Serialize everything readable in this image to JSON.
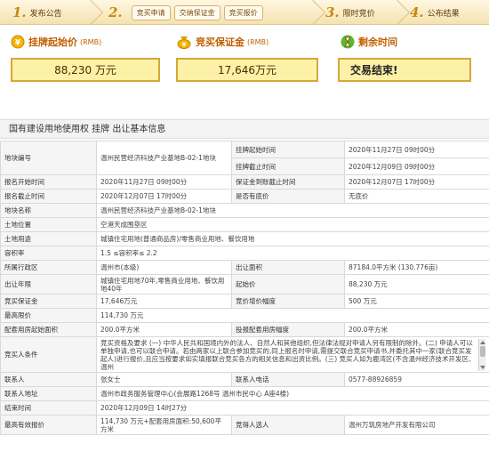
{
  "steps": {
    "s1": {
      "num": "1.",
      "label": "发布公告"
    },
    "s2": {
      "num": "2.",
      "subs": [
        "竞买申请",
        "交纳保证金",
        "竞买报价"
      ]
    },
    "s3": {
      "num": "3.",
      "label": "限时竞价"
    },
    "s4": {
      "num": "4.",
      "label": "公布结果"
    }
  },
  "prices": {
    "start_label": "挂牌起始价",
    "start_unit": "(RMB)",
    "start_value": "88,230 万元",
    "deposit_label": "竞买保证金",
    "deposit_unit": "(RMB)",
    "deposit_value": "17,646万元",
    "remain_label": "剩余时间",
    "remain_value": "交易结束!"
  },
  "section_title": "国有建设用地使用权 挂牌 出让基本信息",
  "rows": {
    "r1": {
      "k1": "地块编号",
      "v1": "温州民营经济科技产业基地B-02-1地块",
      "k2": "挂牌起始时间",
      "v2": "2020年11月27日 09时00分"
    },
    "r1b": {
      "k2": "挂牌截止时间",
      "v2": "2020年12月09日 09时00分"
    },
    "r2": {
      "k1": "报名开始时间",
      "v1": "2020年11月27日 09时00分",
      "k2": "保证金到账截止时间",
      "v2": "2020年12月07日 17时00分"
    },
    "r3": {
      "k1": "报名截止时间",
      "v1": "2020年12月07日 17时00分",
      "k2": "是否有底价",
      "v2": "无底价"
    },
    "r4": {
      "k1": "地块名称",
      "v1": "温州民营经济科技产业基地B-02-1地块"
    },
    "r5": {
      "k1": "土地位置",
      "v1": "空港天成围垦区"
    },
    "r6": {
      "k1": "土地用途",
      "v1": "城镇住宅用地(普通商品房)/零售商业用地、餐饮用地"
    },
    "r7": {
      "k1": "容积率",
      "v1": "1.5 ≤容积率≤ 2.2"
    },
    "r8": {
      "k1": "所属行政区",
      "v1": "温州市(本级)",
      "k2": "出让面积",
      "v2": "87184.0平方米 (130.776亩)"
    },
    "r9": {
      "k1": "出让年限",
      "v1": "城镇住宅用地70年,零售商业用地、餐饮用地40年",
      "k2": "起始价",
      "v2": "88,230 万元"
    },
    "r10": {
      "k1": "竞买保证金",
      "v1": "17,646万元",
      "k2": "竞价增价幅度",
      "v2": "500 万元"
    },
    "r11": {
      "k1": "最高限价",
      "v1": "114,730 万元"
    },
    "r12": {
      "k1": "配套用房起始面积",
      "v1": "200.0平方米",
      "k2": "投报配套用房幅度",
      "v2": "200.0平方米"
    },
    "r13": {
      "k1": "竞买人条件",
      "v1": "竞买资格及要求 (一) 中华人民共和国境内外的法人、自然人和其他组织,但法律法规对申请人另有限制的除外。(二) 申请人可以单独申请,也可以联合申请。若由两家以上联合参加竞买的,同上报名时申请,需提交联合竞买申请书,并委托其中一家(联合竞买发起人)进行报价,且应当按要求如实填报联合竞买各方的相关信息和出资比例。(三) 竞买人如为鹿湾区(不含温州经济技术开发区、温州"
    },
    "r14": {
      "k1": "联系人",
      "v1": "张女士",
      "k2": "联系人电话",
      "v2": "0577-88926859"
    },
    "r15": {
      "k1": "联系人地址",
      "v1": "温州市政务服务管理中心(会展路1268号 温州市民中心 A座4楼)"
    },
    "r16": {
      "k1": "结束时间",
      "v1": "2020年12月09日 14时27分"
    },
    "r17": {
      "k1": "最高有效报价",
      "v1": "114,730 万元+配套用房面积:50,600平方米",
      "k2": "竞得人选人",
      "v2": "温州万筑房地产开发有限公司"
    }
  }
}
